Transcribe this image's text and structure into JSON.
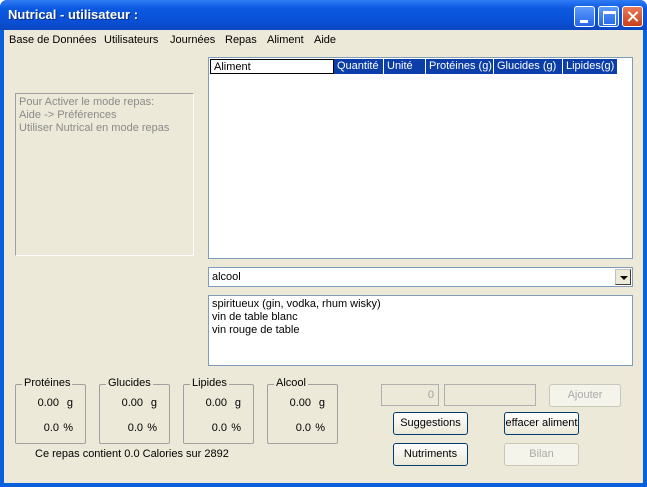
{
  "window": {
    "title": "Nutrical - utilisateur :"
  },
  "menu": [
    "Base de Données",
    "Utilisateurs",
    "Journées",
    "Repas",
    "Aliment",
    "Aide"
  ],
  "info_box": {
    "lines": [
      "Pour Activer le mode repas:",
      "Aide -> Préférences",
      "Utiliser Nutrical en mode repas"
    ]
  },
  "table": {
    "columns": [
      "Aliment",
      "Quantité",
      "Unité",
      "Protéines  (g)",
      "Glucides (g)",
      "Lipides(g)"
    ]
  },
  "category_combo": {
    "value": "alcool"
  },
  "food_list": [
    "spiritueux (gin, vodka, rhum wisky)",
    "vin de table blanc",
    "vin rouge de table"
  ],
  "nutrients": [
    {
      "name": "Protéines",
      "amount": "0.00",
      "unit": "g",
      "percent": "0.0",
      "pct_unit": "%"
    },
    {
      "name": "Glucides",
      "amount": "0.00",
      "unit": "g",
      "percent": "0.0",
      "pct_unit": "%"
    },
    {
      "name": "Lipides",
      "amount": "0.00",
      "unit": "g",
      "percent": "0.0",
      "pct_unit": "%"
    },
    {
      "name": "Alcool",
      "amount": "0.00",
      "unit": "g",
      "percent": "0.0",
      "pct_unit": "%"
    }
  ],
  "summary": "Ce repas contient 0.0 Calories sur 2892",
  "quantity_field": {
    "value": "0"
  },
  "buttons": {
    "add": "Ajouter",
    "suggestions": "Suggestions",
    "delete_food": "effacer aliment",
    "nutrients": "Nutriments",
    "report": "Bilan"
  }
}
